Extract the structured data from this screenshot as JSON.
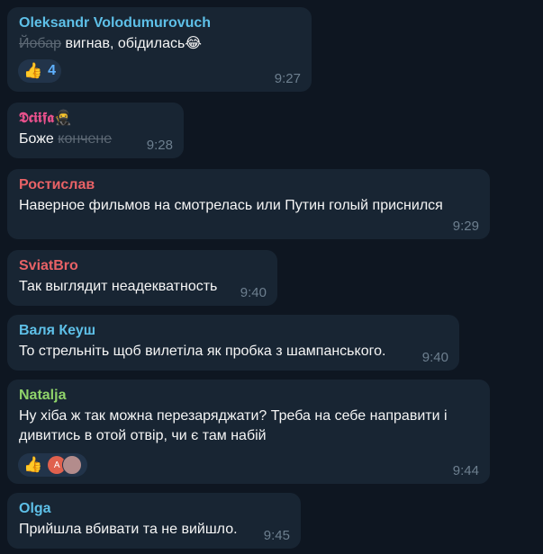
{
  "messages": [
    {
      "sender": "Oleksandr Volodumurovuch",
      "sender_color": "#5ec0e8",
      "text_strike": "Йобар",
      "text": " вигнав, обідилась😂",
      "reaction": {
        "emoji": "👍",
        "count": "4"
      },
      "time": "9:27"
    },
    {
      "sender": "𝕯𝖈𝖎𝖎𝖋𝖆🥷",
      "sender_color": "#e8518c",
      "text": "Боже ",
      "text_strike": "кончене",
      "time": "9:28"
    },
    {
      "sender": "Ростислав",
      "sender_color": "#e86266",
      "text": "Наверное фильмов на смотрелась или Путин голый приснился",
      "time": "9:29"
    },
    {
      "sender": "SviatBro",
      "sender_color": "#e86266",
      "text": "Так выглядит неадекватность",
      "time": "9:40"
    },
    {
      "sender": "Валя Кеуш",
      "sender_color": "#5ec0e8",
      "text": "То стрельніть щоб вилетіла як пробка з шампанського.",
      "time": "9:40"
    },
    {
      "sender": "Natalja",
      "sender_color": "#8fd36a",
      "text": "Ну хіба ж так можна перезаряджати? Треба на себе направити і дивитись в отой отвір, чи є там набій",
      "reaction": {
        "emoji": "👍",
        "avatar": "A"
      },
      "time": "9:44"
    },
    {
      "sender": "Olga",
      "sender_color": "#5ec0e8",
      "text": "Прийшла вбивати та не вийшло.",
      "time": "9:45"
    }
  ]
}
